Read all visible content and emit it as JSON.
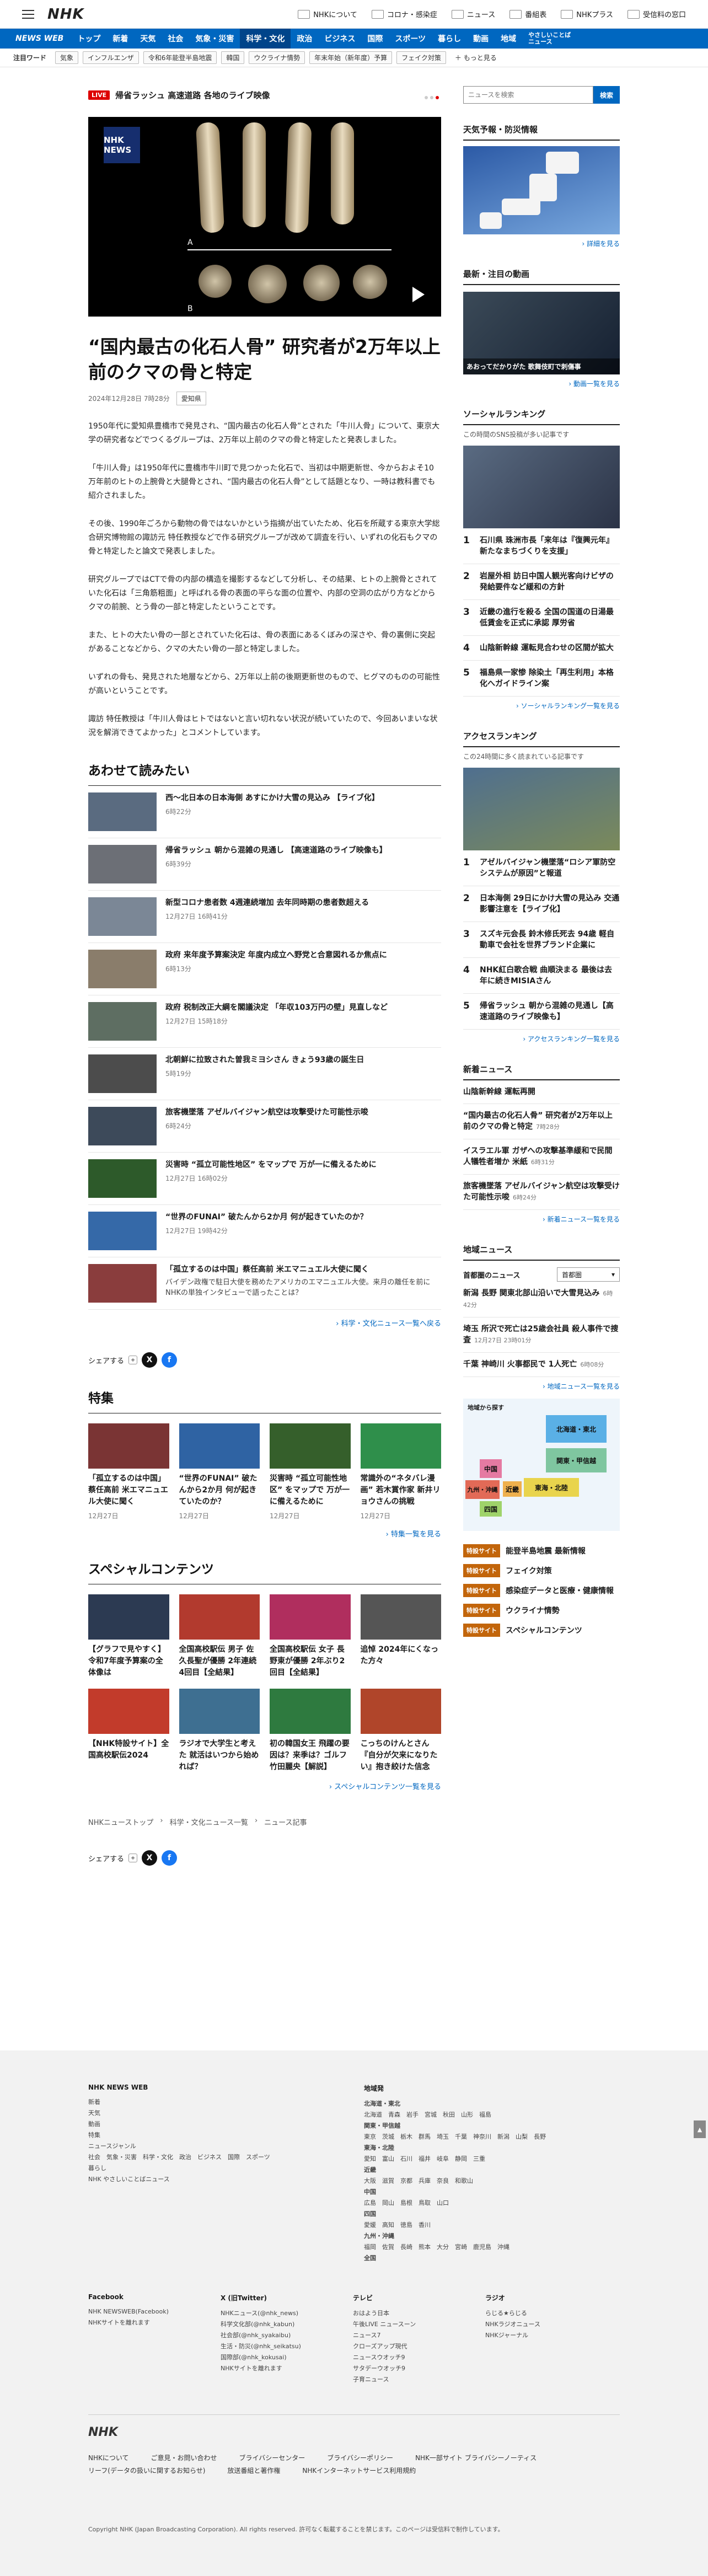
{
  "header": {
    "logo": "NHK",
    "links": [
      "NHKについて",
      "コロナ・感染症",
      "ニュース",
      "番組表",
      "NHKプラス",
      "受信料の窓口"
    ]
  },
  "nav": {
    "brand": "NEWS WEB",
    "items": [
      "トップ",
      "新着",
      "天気",
      "社会",
      "気象・災害",
      "科学・文化",
      "政治",
      "ビジネス",
      "国際",
      "スポーツ",
      "暮らし",
      "動画",
      "地域"
    ],
    "active": "科学・文化",
    "easy": "やさしいことばニュース"
  },
  "keywords": {
    "label": "注目ワード",
    "items": [
      "気象",
      "インフルエンザ",
      "令和6年能登半島地震",
      "韓国",
      "ウクライナ情勢",
      "年末年始（新年度）予算",
      "フェイク対策"
    ],
    "more": "もっと見る"
  },
  "live": {
    "badge": "LIVE",
    "text": "帰省ラッシュ 高速道路 各地のライブ映像"
  },
  "hero": {
    "tag": "NHK NEWS",
    "label_a": "A",
    "label_b": "B"
  },
  "article": {
    "title": "“国内最古の化石人骨” 研究者が2万年以上前のクマの骨と特定",
    "date": "2024年12月28日 7時28分",
    "category": "愛知県",
    "paragraphs": [
      "1950年代に愛知県豊橋市で発見され、“国内最古の化石人骨”とされた「牛川人骨」について、東京大学の研究者などでつくるグループは、2万年以上前のクマの骨と特定したと発表しました。",
      "「牛川人骨」は1950年代に豊橋市牛川町で見つかった化石で、当初は中期更新世、今からおよそ10万年前のヒトの上腕骨と大腿骨とされ、“国内最古の化石人骨”として話題となり、一時は教科書でも紹介されました。",
      "その後、1990年ごろから動物の骨ではないかという指摘が出ていたため、化石を所蔵する東京大学総合研究博物館の諏訪元 特任教授などで作る研究グループが改めて調査を行い、いずれの化石もクマの骨と特定したと論文で発表しました。",
      "研究グループではCTで骨の内部の構造を撮影するなどして分析し、その結果、ヒトの上腕骨とされていた化石は「三角筋粗面」と呼ばれる骨の表面の平らな面の位置や、内部の空洞の広がり方などからクマの前腕、とう骨の一部と特定したということです。",
      "また、ヒトの大たい骨の一部とされていた化石は、骨の表面にあるくぼみの深さや、骨の裏側に突起があることなどから、クマの大たい骨の一部と特定しました。",
      "いずれの骨も、発見された地層などから、2万年以上前の後期更新世のもので、ヒグマのものの可能性が高いということです。",
      "諏訪 特任教授は「牛川人骨はヒトではないと言い切れない状況が続いていたので、今回あいまいな状況を解消できてよかった」とコメントしています。"
    ]
  },
  "related": {
    "heading": "あわせて読みたい",
    "items": [
      {
        "title": "西～北日本の日本海側 あすにかけ大雪の見込み 【ライブ化】",
        "date": "6時22分",
        "thumb": "#5a6b80"
      },
      {
        "title": "帰省ラッシュ 朝から混雑の見通し 【高速道路のライブ映像も】",
        "date": "6時39分",
        "thumb": "#6c6f76"
      },
      {
        "title": "新型コロナ患者数 4週連続増加 去年同時期の患者数超える",
        "date": "12月27日 16時41分",
        "thumb": "#7b8796"
      },
      {
        "title": "政府 来年度予算案決定 年度内成立へ野党と合意図れるか焦点に",
        "date": "6時13分",
        "thumb": "#8a7d6b"
      },
      {
        "title": "政府 税制改正大綱を閣議決定 「年収103万円の壁」見直しなど",
        "date": "12月27日 15時18分",
        "thumb": "#5e6e62"
      },
      {
        "title": "北朝鮮に拉致された曽我ミヨシさん きょう93歳の誕生日",
        "date": "5時19分",
        "thumb": "#4c4c4c"
      },
      {
        "title": "旅客機墜落 アゼルバイジャン航空は攻撃受けた可能性示唆",
        "date": "6時24分",
        "thumb": "#3d4a5a"
      },
      {
        "title": "災害時 “孤立可能性地区” をマップで 万が一に備えるために",
        "date": "12月27日 16時02分",
        "thumb": "#2d5a2a"
      },
      {
        "title": "“世界のFUNAI” 破たんから2か月 何が起きていたのか？",
        "date": "12月27日 19時42分",
        "thumb": "#3569a8"
      },
      {
        "title": "「孤立するのは中国」蔡任高前 米エマニュエル大使に聞く",
        "date": "",
        "summary": "バイデン政権で駐日大使を務めたアメリカのエマニュエル大使。来月の離任を前にNHKの単独インタビューで語ったことは？",
        "thumb": "#8a3d3d"
      }
    ],
    "more": "科学・文化ニュース一覧へ戻る"
  },
  "share": {
    "label": "シェアする",
    "more": "+"
  },
  "tokushu": {
    "heading": "特集",
    "items": [
      {
        "title": "「孤立するのは中国」蔡任高前 米エマニュエル大使に聞く",
        "date": "12月27日",
        "thumb": "#7a3434"
      },
      {
        "title": "“世界のFUNAI” 破たんから2か月 何が起きていたのか？",
        "date": "12月27日",
        "thumb": "#2f63a3"
      },
      {
        "title": "災害時 “孤立可能性地区” をマップで 万が一に備えるために",
        "date": "12月27日",
        "thumb": "#355f2b"
      },
      {
        "title": "常識外の“ネタバレ漫画” 若木賞作家 新井リョウさんの挑戦",
        "date": "12月27日",
        "thumb": "#2f8f4b"
      }
    ],
    "more": "特集一覧を見る"
  },
  "special": {
    "heading": "スペシャルコンテンツ",
    "items": [
      {
        "title": "【グラフで見やすく】令和7年度予算案の全体像は",
        "thumb": "#2c3a52"
      },
      {
        "title": "全国高校駅伝 男子 佐久長聖が優勝 2年連続4回目【全結果】",
        "thumb": "#b23a2e"
      },
      {
        "title": "全国高校駅伝 女子 長野東が優勝 2年ぶり2回目【全結果】",
        "thumb": "#b02e5e"
      },
      {
        "title": "追悼 2024年にくなった方々",
        "thumb": "#555555"
      },
      {
        "title": "【NHK特設サイト】全国高校駅伝2024",
        "thumb": "#c23b2b"
      },
      {
        "title": "ラジオで大学生と考えた 就活はいつから始めれば？",
        "thumb": "#3e6f91"
      },
      {
        "title": "初の韓国女王 飛躍の要因は？来季は？ゴルフ 竹田麗央【解説】",
        "thumb": "#2e7a3f"
      },
      {
        "title": "こっちのけんとさん『自分が欠来になりたい』抱き絞けた信念",
        "thumb": "#b0452a"
      }
    ],
    "more": "スペシャルコンテンツ一覧を見る"
  },
  "breadcrumbs": [
    "NHKニューストップ",
    "科学・文化ニュース一覧",
    "ニュース記事"
  ],
  "sidebar": {
    "search_placeholder": "ニュースを検索",
    "search_button": "検索",
    "weather": {
      "heading": "天気予報・防災情報",
      "more": "詳細を見る"
    },
    "video": {
      "heading": "最新・注目の動画",
      "caption": "あおってだかりがた 歌舞伎町で刺傷事",
      "more": "動画一覧を見る"
    },
    "social": {
      "heading": "ソーシャルランキング",
      "sub": "この時間のSNS投稿が多い記事です",
      "items": [
        "石川県 珠洲市長「来年は『復興元年』新たなまちづくりを支援」",
        "岩屋外相 訪日中国人観光客向けビザの発給要件など緩和の方針",
        "近畿の進行を殺る 全国の国道の日湯最低賃金を正式に承認 厚労省",
        "山陰新幹線 運転見合わせの区間が拡大",
        "福島県一家惨 除染土「再生利用」本格化へガイドライン案"
      ],
      "more": "ソーシャルランキング一覧を見る"
    },
    "access": {
      "heading": "アクセスランキング",
      "sub": "この24時間に多く読まれている記事です",
      "items": [
        "アゼルバイジャン機墜落“ロシア軍防空システムが原因”と報道",
        "日本海側 29日にかけ大雪の見込み 交通影響注意を【ライブ化】",
        "スズキ元会長 鈴木修氏死去 94歳 軽自動車で会社を世界ブランド企業に",
        "NHK紅白歌合戦 曲順決まる 最後は去年に続きMISIAさん",
        "帰省ラッシュ 朝から混雑の見通し【高速道路のライブ映像も】"
      ],
      "more": "アクセスランキング一覧を見る"
    },
    "latest": {
      "heading": "新着ニュース",
      "items": [
        {
          "title": "山陰新幹線 運転再開",
          "date": ""
        },
        {
          "title": "“国内最古の化石人骨” 研究者が2万年以上前のクマの骨と特定",
          "date": "7時28分"
        },
        {
          "title": "イスラエル軍 ガザへの攻撃基準緩和で民間人犠牲者増か 米紙",
          "date": "6時31分"
        },
        {
          "title": "旅客機墜落 アゼルバイジャン航空は攻撃受けた可能性示唆",
          "date": "6時24分"
        }
      ],
      "more": "新着ニュース一覧を見る"
    },
    "regional": {
      "heading": "地域ニュース",
      "area_label": "首都圏のニュース",
      "select": "首都圏",
      "items": [
        {
          "title": "新潟 長野 関東北部山沿いで大雪見込み",
          "date": "6時42分"
        },
        {
          "title": "埼玉 所沢で死亡は25歳会社員 殺人事件で捜査",
          "date": "12月27日 23時01分"
        },
        {
          "title": "千葉 神崎川 火事都民で 1人死亡",
          "date": "6時08分"
        }
      ],
      "more": "地域ニュース一覧を見る",
      "map_label": "地域から探す",
      "regions": [
        "北海道・東北",
        "関東・甲信越",
        "東海・北陸",
        "近畿",
        "中国",
        "四国",
        "九州・沖縄"
      ]
    },
    "special_sites": [
      {
        "tag": "特設サイト",
        "title": "能登半島地震 最新情報"
      },
      {
        "tag": "特設サイト",
        "title": "フェイク対策"
      },
      {
        "tag": "特設サイト",
        "title": "感染症データと医療・健康情報"
      },
      {
        "tag": "特設サイト",
        "title": "ウクライナ情勢"
      },
      {
        "tag": "特設サイト",
        "title": "スペシャルコンテンツ"
      }
    ]
  },
  "footer": {
    "brand": "NHK NEWS WEB",
    "col1": [
      "新着",
      "天気",
      "動画",
      "特集",
      "ニュースジャンル",
      "社会　気象・災害　科学・文化　政治　ビジネス　国際　スポーツ",
      "暮らし",
      "NHK やさしいことばニュース"
    ],
    "region_heading": "地域発",
    "regions": [
      "北海道・東北",
      "北海道　青森　岩手　宮城　秋田　山形　福島",
      "関東・甲信越",
      "東京　茨城　栃木　群馬　埼玉　千葉　神奈川　新潟　山梨　長野",
      "東海・北陸",
      "愛知　富山　石川　福井　岐阜　静岡　三重",
      "近畿",
      "大阪　滋賀　京都　兵庫　奈良　和歌山",
      "中国",
      "広島　岡山　島根　鳥取　山口",
      "四国",
      "愛媛　高知　徳島　香川",
      "九州・沖縄",
      "福岡　佐賀　長崎　熊本　大分　宮崎　鹿児島　沖縄",
      "全国"
    ],
    "sns": [
      {
        "h": "Facebook",
        "items": [
          "NHK NEWSWEB(Facebook)",
          "NHKサイトを離れます"
        ]
      },
      {
        "h": "X (旧Twitter)",
        "items": [
          "NHKニュース(@nhk_news)",
          "科学文化部(@nhk_kabun)",
          "社会部(@nhk_syakaibu)",
          "生活・防災(@nhk_seikatsu)",
          "国際部(@nhk_kokusai)",
          "NHKサイトを離れます"
        ]
      },
      {
        "h": "テレビ",
        "items": [
          "おはよう日本",
          "午後LIVE ニュースーン",
          "ニュース7",
          "クローズアップ現代",
          "ニュースウオッチ9",
          "サタデーウオッチ9",
          "子育ニュース"
        ]
      },
      {
        "h": "ラジオ",
        "items": [
          "らじる★らじる",
          "NHKラジオニュース",
          "NHKジャーナル"
        ]
      }
    ],
    "logo": "NHK",
    "bottom_links": [
      "NHKについて",
      "ご意見・お問い合わせ",
      "ブライバシーセンター",
      "ブライバシーポリシー",
      "NHK一部サイト ブライバシーノーティス",
      "リーフ(データの扱いに関するお知らせ)",
      "放送番組と著作権",
      "NHKインターネットサービス利用規約"
    ],
    "copyright": "Copyright NHK (Japan Broadcasting Corporation). All rights reserved. 許可なく転載することを禁じます。このページは受信料で制作しています。"
  },
  "scroll_top": "▲"
}
